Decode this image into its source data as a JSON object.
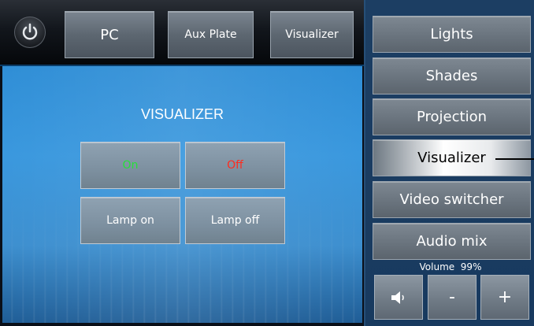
{
  "topbar": {
    "sources": [
      "PC",
      "Aux Plate",
      "Visualizer"
    ]
  },
  "panel": {
    "title": "VISUALIZER",
    "buttons": {
      "on": "On",
      "off": "Off",
      "lamp_on": "Lamp on",
      "lamp_off": "Lamp off"
    }
  },
  "sidebar": {
    "items": [
      "Lights",
      "Shades",
      "Projection",
      "Visualizer",
      "Video switcher",
      "Audio mix"
    ],
    "active": "Visualizer"
  },
  "volume": {
    "label": "Volume",
    "value": "99%",
    "minus": "-",
    "plus": "+"
  },
  "colors": {
    "on_text": "#27e03a",
    "off_text": "#ff2b1e"
  },
  "icons": [
    "power-icon",
    "speaker-icon"
  ]
}
